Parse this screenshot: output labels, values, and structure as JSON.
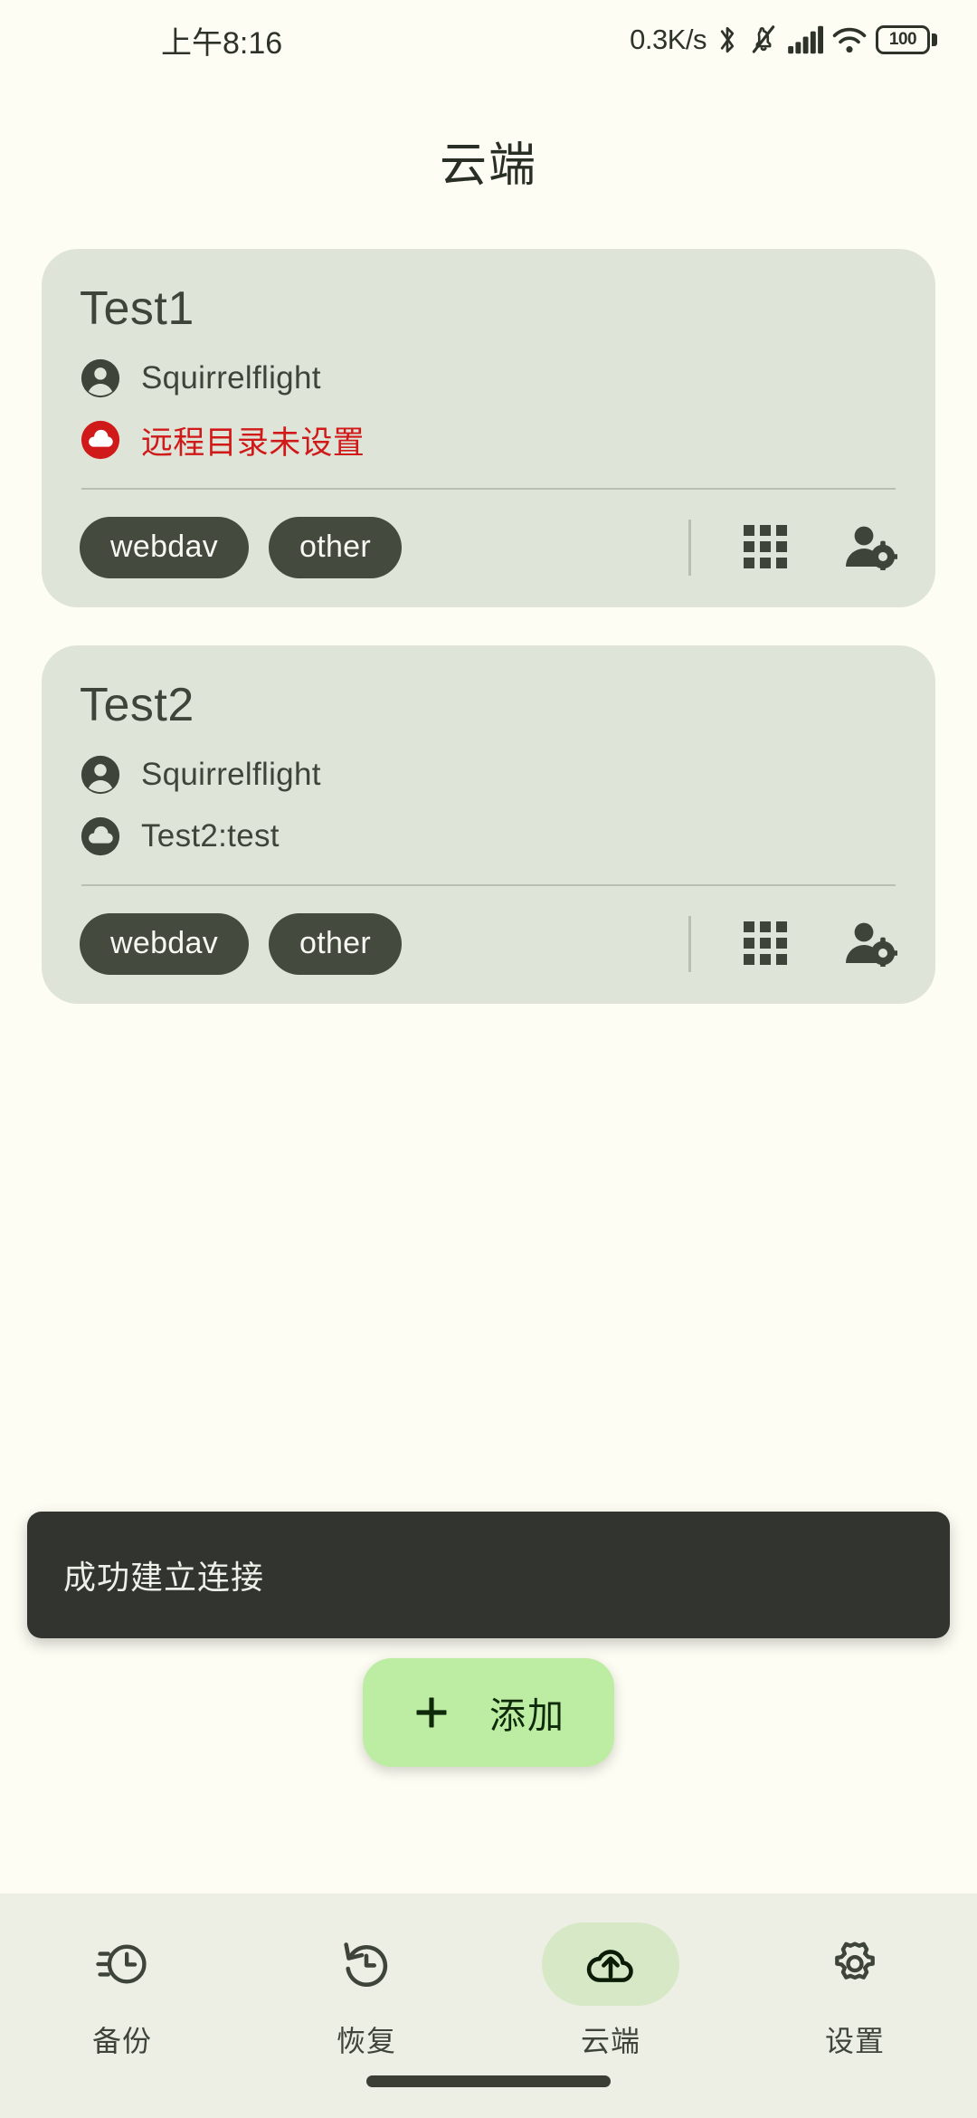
{
  "status_bar": {
    "time": "上午8:16",
    "net_speed": "0.3K/s",
    "battery_level": "100",
    "icons": [
      "bluetooth-icon",
      "notifications-muted-icon",
      "cellular-signal-icon",
      "wifi-icon",
      "battery-icon"
    ]
  },
  "header": {
    "title": "云端"
  },
  "accounts": [
    {
      "name": "Test1",
      "user": "Squirrelflight",
      "remote": "远程目录未设置",
      "remote_state": "error",
      "chips": [
        "webdav",
        "other"
      ],
      "icons": [
        "grid-apps-icon",
        "person-settings-icon"
      ]
    },
    {
      "name": "Test2",
      "user": "Squirrelflight",
      "remote": "Test2:test",
      "remote_state": "ok",
      "chips": [
        "webdav",
        "other"
      ],
      "icons": [
        "grid-apps-icon",
        "person-settings-icon"
      ]
    }
  ],
  "toast": {
    "message": "成功建立连接"
  },
  "fab": {
    "label": "添加",
    "icon": "plus-icon"
  },
  "bottom_nav": {
    "items": [
      {
        "label": "备份",
        "icon": "backup-schedule-icon",
        "active": false
      },
      {
        "label": "恢复",
        "icon": "restore-history-icon",
        "active": false
      },
      {
        "label": "云端",
        "icon": "cloud-upload-icon",
        "active": true
      },
      {
        "label": "设置",
        "icon": "gear-icon",
        "active": false
      }
    ]
  },
  "colors": {
    "background": "#FDFDF3",
    "card": "#DFE4D8",
    "chip": "#444A3E",
    "error": "#D01919",
    "accent": "#BDEDA3",
    "nav_bar": "#EDEFE5",
    "nav_active_pill": "#D6E8C6",
    "toast": "#32352F",
    "text": "#3E4439"
  }
}
